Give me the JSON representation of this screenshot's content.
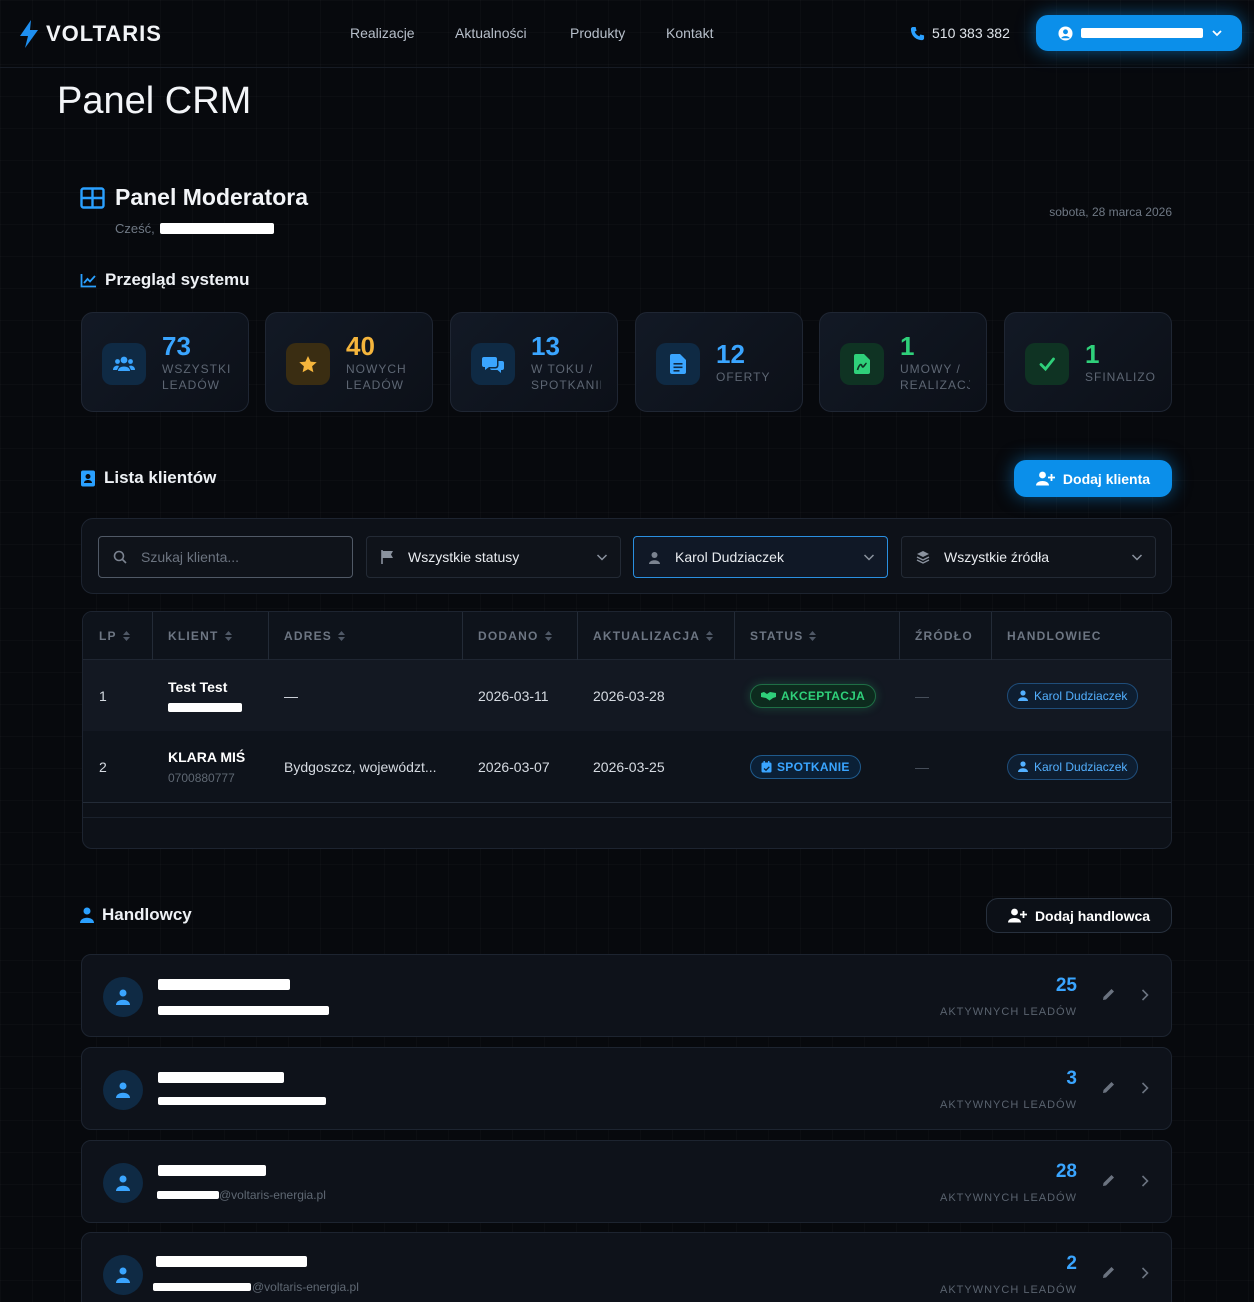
{
  "brand": {
    "name": "VOLTARIS"
  },
  "nav": [
    {
      "label": "Realizacje"
    },
    {
      "label": "Aktualności"
    },
    {
      "label": "Produkty"
    },
    {
      "label": "Kontakt"
    }
  ],
  "phone": "510 383 382",
  "page_title": "Panel CRM",
  "moderator": {
    "title": "Panel Moderatora",
    "greeting": "Cześć,",
    "date": "sobota, 28 marca 2026"
  },
  "overview": {
    "title": "Przegląd systemu",
    "stats": [
      {
        "value": "73",
        "label1": "WSZYSTKICH",
        "label2": "LEADÓW",
        "color": "#3aa5ff",
        "icon": "users-icon"
      },
      {
        "value": "40",
        "label1": "NOWYCH",
        "label2": "LEADÓW",
        "color": "#f5b53c",
        "icon": "star-icon"
      },
      {
        "value": "13",
        "label1": "W TOKU /",
        "label2": "SPOTKANIE",
        "color": "#3aa5ff",
        "icon": "chat-icon"
      },
      {
        "value": "12",
        "label1": "OFERTY",
        "label2": "",
        "color": "#3aa5ff",
        "icon": "document-icon"
      },
      {
        "value": "1",
        "label1": "UMOWY /",
        "label2": "REALIZACJA",
        "color": "#2fd07a",
        "icon": "contract-icon"
      },
      {
        "value": "1",
        "label1": "SFINALIZOWANE",
        "label2": "",
        "color": "#2fd07a",
        "icon": "check-icon"
      }
    ]
  },
  "clients": {
    "title": "Lista klientów",
    "add_label": "Dodaj klienta",
    "filters": {
      "search_placeholder": "Szukaj klienta...",
      "status": "Wszystkie statusy",
      "rep": "Karol Dudziaczek",
      "source": "Wszystkie źródła"
    },
    "columns": [
      "LP",
      "KLIENT",
      "ADRES",
      "DODANO",
      "AKTUALIZACJA",
      "STATUS",
      "ŹRÓDŁO",
      "HANDLOWIEC"
    ],
    "rows": [
      {
        "lp": "1",
        "name": "Test Test",
        "phone": "",
        "address": "—",
        "added": "2026-03-11",
        "updated": "2026-03-28",
        "status": "AKCEPTACJA",
        "source": "—",
        "rep": "Karol Dudziaczek"
      },
      {
        "lp": "2",
        "name": "KLARA MIŚ",
        "phone": "0700880777",
        "address": "Bydgoszcz, województ...",
        "added": "2026-03-07",
        "updated": "2026-03-25",
        "status": "SPOTKANIE",
        "source": "—",
        "rep": "Karol Dudziaczek"
      }
    ]
  },
  "sales": {
    "title": "Handlowcy",
    "add_label": "Dodaj handlowca",
    "people": [
      {
        "count": "25",
        "label": "AKTYWNYCH LEADÓW",
        "email_suffix": ""
      },
      {
        "count": "3",
        "label": "AKTYWNYCH LEADÓW",
        "email_suffix": ""
      },
      {
        "count": "28",
        "label": "AKTYWNYCH LEADÓW",
        "email_suffix": "@voltaris-energia.pl"
      },
      {
        "count": "2",
        "label": "AKTYWNYCH LEADÓW",
        "email_suffix": "@voltaris-energia.pl"
      }
    ]
  }
}
